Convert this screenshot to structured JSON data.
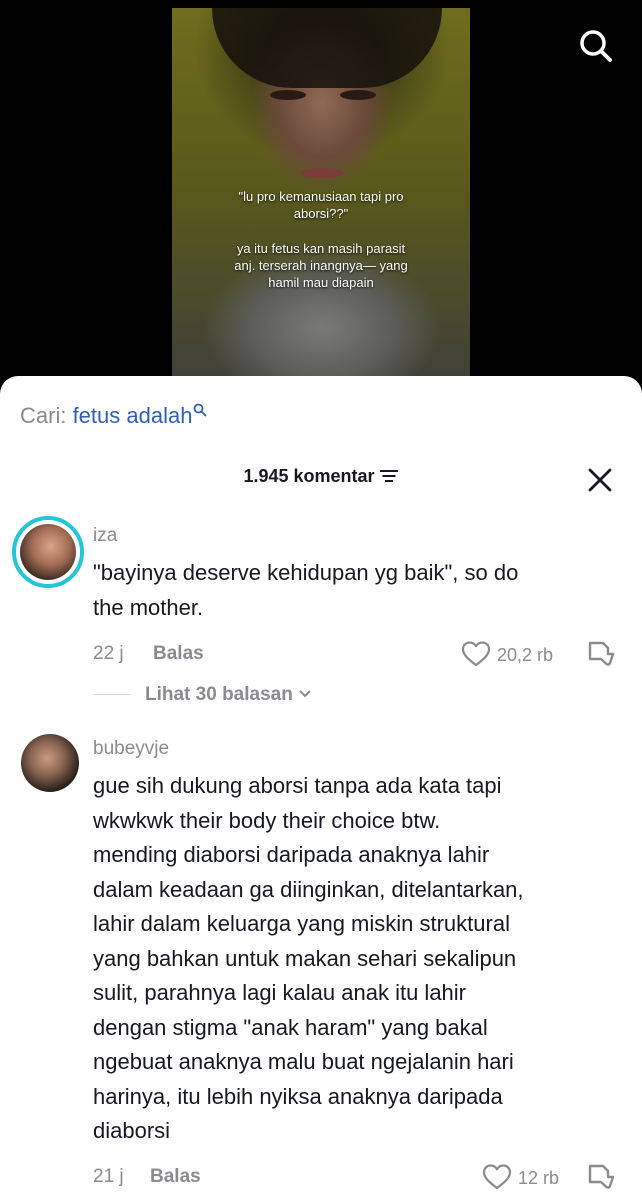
{
  "video": {
    "caption_line1": "\"lu pro kemanusiaan tapi pro\naborsi??\"",
    "caption_line2": "ya itu fetus kan masih parasit\nanj. terserah inangnya— yang\nhamil mau diapain"
  },
  "sheet": {
    "search_prefix": "Cari: ",
    "search_term": "fetus adalah",
    "comment_count": "1.945 komentar"
  },
  "comments": [
    {
      "username": "iza",
      "text": "\"bayinya deserve kehidupan yg baik\", so do\nthe mother.",
      "time": "22 j",
      "reply": "Balas",
      "likes": "20,2 rb",
      "view_replies": "Lihat 30 balasan"
    },
    {
      "username": "bubeyvje",
      "text": "gue sih dukung aborsi tanpa ada kata tapi\nwkwkwk their body their choice btw.\nmending diaborsi daripada anaknya lahir\ndalam keadaan ga diinginkan, ditelantarkan,\nlahir dalam keluarga yang miskin struktural\nyang bahkan untuk makan sehari sekalipun\nsulit, parahnya lagi kalau anak itu lahir\ndengan stigma \"anak haram\" yang bakal\nngebuat anaknya malu buat ngejalanin hari\nharinya, itu lebih nyiksa anaknya daripada\ndiaborsi",
      "time": "21 j",
      "reply": "Balas",
      "likes": "12 rb"
    }
  ],
  "icons": [
    "search-icon",
    "filter-icon",
    "close-icon",
    "heart-icon",
    "dislike-icon",
    "chevron-down-icon"
  ],
  "colors": {
    "accent_link": "#2f5fb0",
    "story_ring": "#25c4d6",
    "muted": "#8a8b91",
    "text": "#161823"
  }
}
